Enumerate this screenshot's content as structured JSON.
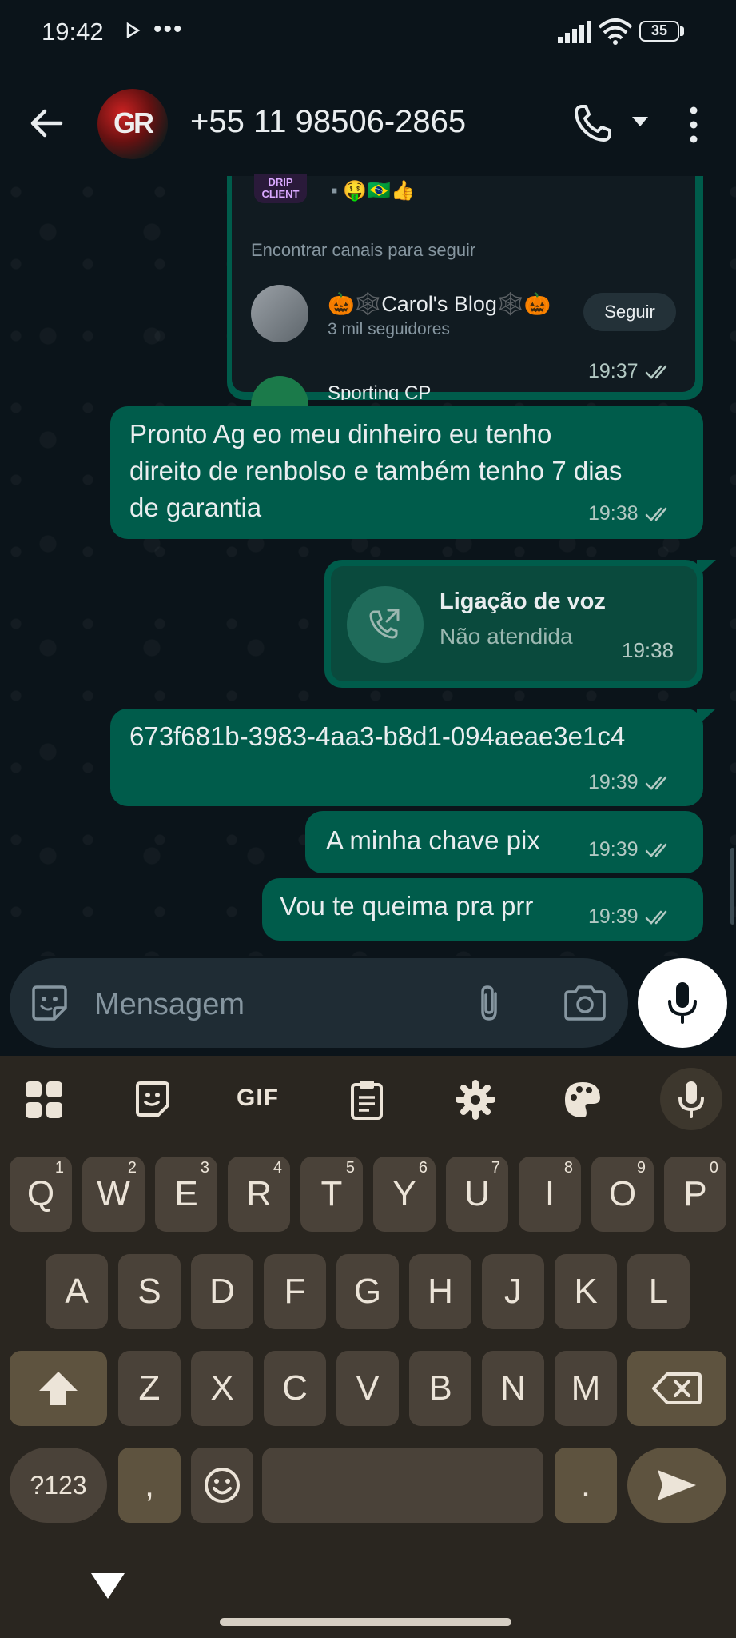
{
  "status_bar": {
    "time": "19:42",
    "more": "•••",
    "battery": "35"
  },
  "header": {
    "contact_name": "+55 11 98506-2865",
    "avatar_text": "GR"
  },
  "channel_card": {
    "logo_text": "DRIP CLIENT",
    "preview": "▪ 🤑🇧🇷👍",
    "find_channels_label": "Encontrar canais para seguir",
    "channel_name": "🎃🕸️Carol's Blog🕸️🎃",
    "channel_followers": "3 mil seguidores",
    "follow_label": "Seguir",
    "next_channel": "Sporting CP",
    "time": "19:37"
  },
  "messages": [
    {
      "text": "Pronto Ag eo meu dinheiro eu tenho direito de renbolso e também tenho 7 dias de garantia",
      "time": "19:38"
    },
    {
      "text": "673f681b-3983-4aa3-b8d1-094aeae3e1c4",
      "time": "19:39"
    },
    {
      "text": "A minha chave pix",
      "time": "19:39"
    },
    {
      "text": "Vou te queima pra prr",
      "time": "19:39"
    }
  ],
  "voice_call": {
    "title": "Ligação de voz",
    "status": "Não atendida",
    "time": "19:38"
  },
  "input": {
    "placeholder": "Mensagem"
  },
  "keyboard": {
    "toolbar": {
      "gif": "GIF"
    },
    "row1": [
      {
        "key": "Q",
        "num": "1"
      },
      {
        "key": "W",
        "num": "2"
      },
      {
        "key": "E",
        "num": "3"
      },
      {
        "key": "R",
        "num": "4"
      },
      {
        "key": "T",
        "num": "5"
      },
      {
        "key": "Y",
        "num": "6"
      },
      {
        "key": "U",
        "num": "7"
      },
      {
        "key": "I",
        "num": "8"
      },
      {
        "key": "O",
        "num": "9"
      },
      {
        "key": "P",
        "num": "0"
      }
    ],
    "row2": [
      "A",
      "S",
      "D",
      "F",
      "G",
      "H",
      "J",
      "K",
      "L"
    ],
    "row3": [
      "Z",
      "X",
      "C",
      "V",
      "B",
      "N",
      "M"
    ],
    "symbols_label": "?123",
    "comma": ",",
    "period": "."
  },
  "colors": {
    "outgoing_bubble": "#005c4b",
    "background": "#0b141a",
    "keyboard": "#2a2620",
    "accent": "#00a884"
  }
}
